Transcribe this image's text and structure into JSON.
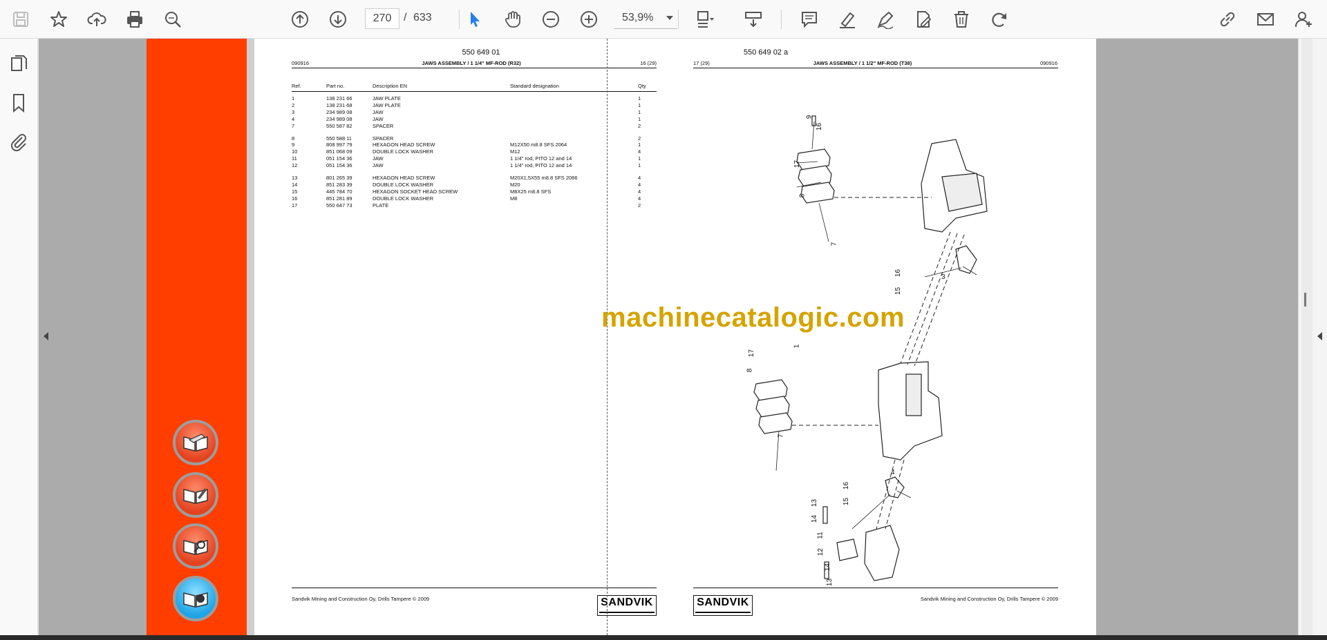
{
  "toolbar": {
    "current_page": "270",
    "page_separator": "/",
    "total_pages": "633",
    "zoom": "53,9%"
  },
  "document": {
    "left_page": {
      "doc_number": "550 649 01",
      "date_code": "090916",
      "title": "JAWS ASSEMBLY / 1 1/4\" MF-ROD (R32)",
      "page_ref": "16 (29)",
      "columns": [
        "Ref.",
        "Part no.",
        "Description EN",
        "Standard designation",
        "Qty"
      ],
      "rows": [
        [
          "1",
          "138 231 66",
          "JAW PLATE",
          "",
          "1"
        ],
        [
          "2",
          "138 231 68",
          "JAW PLATE",
          "",
          "1"
        ],
        [
          "3",
          "234 989 08",
          "JAW",
          "",
          "1"
        ],
        [
          "4",
          "234 989 08",
          "JAW",
          "",
          "1"
        ],
        [
          "7",
          "550 587 82",
          "SPACER",
          "",
          "2"
        ],
        [
          "8",
          "550 588 11",
          "SPACER",
          "",
          "2"
        ],
        [
          "9",
          "808 997 79",
          "HEXAGON HEAD SCREW",
          "M12X50 m8.8 SFS 2064",
          "1"
        ],
        [
          "10",
          "851 068 09",
          "DOUBLE LOCK WASHER",
          "M12",
          "4"
        ],
        [
          "11",
          "051 154 36",
          "JAW",
          "1 1/4\" rod, PITO 12 and 14",
          "1"
        ],
        [
          "12",
          "051 154 36",
          "JAW",
          "1 1/4\" rod, PITO 12 and 14",
          "1"
        ],
        [
          "13",
          "801 265 39",
          "HEXAGON HEAD SCREW",
          "M20X1,5X55 m8.8 SFS 2066",
          "4"
        ],
        [
          "14",
          "851 283 39",
          "DOUBLE LOCK WASHER",
          "M20",
          "4"
        ],
        [
          "15",
          "445 784 70",
          "HEXAGON SOCKET HEAD SCREW",
          "M8X25 m8.8 SFS",
          "4"
        ],
        [
          "16",
          "851 281 89",
          "DOUBLE LOCK WASHER",
          "M8",
          "4"
        ],
        [
          "17",
          "550 647 73",
          "PLATE",
          "",
          "2"
        ]
      ],
      "footer": "Sandvik Mining and Construction Oy, Drills Tampere © 2009",
      "logo": "SANDVIK"
    },
    "right_page": {
      "doc_number": "550 649 02 a",
      "page_ref": "17 (29)",
      "title": "JAWS ASSEMBLY / 1 1/2\" MF-ROD (T38)",
      "date_code": "090916",
      "footer": "Sandvik Mining and Construction Oy, Drills Tampere © 2009",
      "logo": "SANDVIK",
      "callouts": [
        "9",
        "16",
        "17",
        "8",
        "7",
        "16",
        "15",
        "3",
        "17",
        "8",
        "7",
        "16",
        "15",
        "4",
        "13",
        "14",
        "11",
        "12",
        "14",
        "13",
        "1"
      ]
    },
    "watermark": "machinecatalogic.com"
  },
  "icons": {
    "save": "save-icon",
    "bookmark": "star-icon",
    "upload": "cloud-upload-icon",
    "print": "print-icon",
    "search": "zoom-search-icon",
    "prev": "arrow-up-circle-icon",
    "next": "arrow-down-circle-icon",
    "select": "cursor-icon",
    "hand": "hand-icon",
    "zoom_out": "minus-circle-icon",
    "zoom_in": "plus-circle-icon"
  },
  "colors": {
    "accent_orange": "#ff3e00",
    "select_blue": "#2680eb",
    "watermark": "#d4a400"
  }
}
